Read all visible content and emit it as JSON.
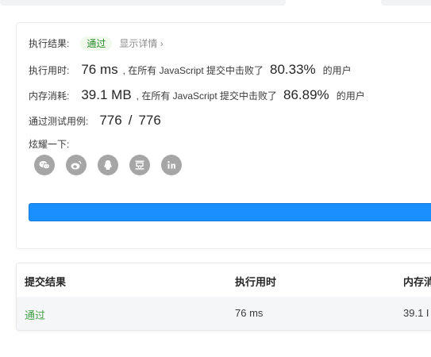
{
  "result": {
    "status_label": "执行结果:",
    "status_badge": "通过",
    "detail_link": "显示详情 ›",
    "runtime": {
      "label": "执行用时:",
      "value": "76 ms",
      "mid_text": ", 在所有 JavaScript 提交中击败了",
      "percent": "80.33%",
      "suffix": "的用户"
    },
    "memory": {
      "label": "内存消耗:",
      "value": "39.1 MB",
      "mid_text": ", 在所有 JavaScript 提交中击败了",
      "percent": "86.89%",
      "suffix": "的用户"
    },
    "tests": {
      "label": "通过测试用例:",
      "passed": "776",
      "separator": "/",
      "total": "776"
    },
    "share": {
      "label": "炫耀一下:",
      "icons": [
        "wechat-icon",
        "weibo-icon",
        "qq-icon",
        "douban-icon",
        "linkedin-icon"
      ],
      "icon_color": "#a6a6a6"
    },
    "progress_color": "#1a90ff"
  },
  "submissions": {
    "columns": [
      "提交结果",
      "执行用时",
      "内存消"
    ],
    "rows": [
      {
        "result": "通过",
        "runtime": "76 ms",
        "memory": "39.1 I"
      }
    ],
    "pass_color": "#43a047"
  }
}
